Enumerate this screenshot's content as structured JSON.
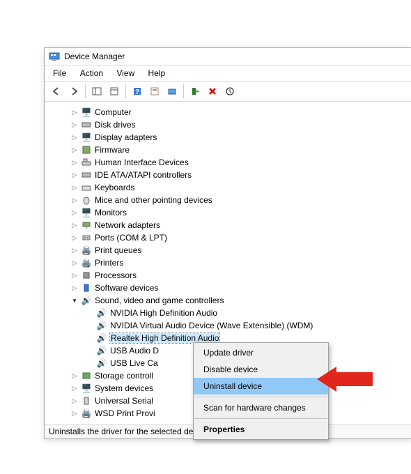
{
  "window": {
    "title": "Device Manager"
  },
  "menu": {
    "file": "File",
    "action": "Action",
    "view": "View",
    "help": "Help"
  },
  "categories": {
    "computer": "Computer",
    "disk_drives": "Disk drives",
    "display_adapters": "Display adapters",
    "firmware": "Firmware",
    "hid": "Human Interface Devices",
    "ide": "IDE ATA/ATAPI controllers",
    "keyboards": "Keyboards",
    "mice": "Mice and other pointing devices",
    "monitors": "Monitors",
    "network": "Network adapters",
    "ports": "Ports (COM & LPT)",
    "print_queues": "Print queues",
    "printers": "Printers",
    "processors": "Processors",
    "software_devices": "Software devices",
    "sound": "Sound, video and game controllers",
    "storage": "Storage controll",
    "system": "System devices",
    "usb": "Universal Serial",
    "wsd": "WSD Print Provi"
  },
  "sound_children": {
    "nvidia_hd": "NVIDIA High Definition Audio",
    "nvidia_virtual": "NVIDIA Virtual Audio Device (Wave Extensible) (WDM)",
    "realtek": "Realtek High Definition Audio",
    "usb_audio": "USB Audio D",
    "usb_live": "USB Live Ca"
  },
  "context": {
    "update": "Update driver",
    "disable": "Disable device",
    "uninstall": "Uninstall device",
    "scan": "Scan for hardware changes",
    "properties": "Properties"
  },
  "status": "Uninstalls the driver for the selected device."
}
